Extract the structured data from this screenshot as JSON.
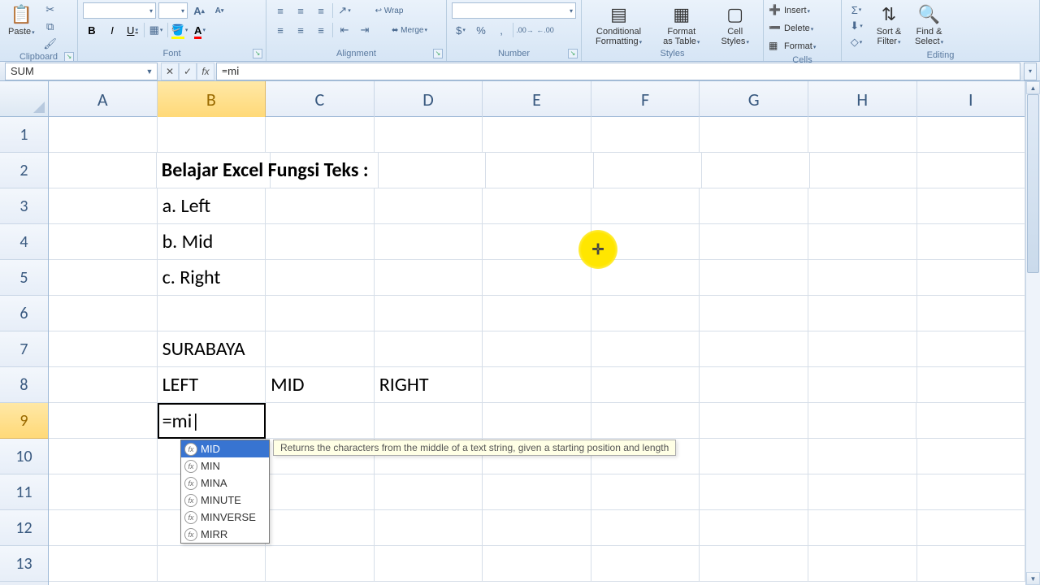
{
  "ribbon": {
    "clipboard": {
      "paste": "Paste",
      "label": "Clipboard"
    },
    "font": {
      "label": "Font",
      "bold": "B",
      "italic": "I",
      "underline": "U",
      "name_val": "",
      "size_val": "",
      "grow": "A",
      "shrink": "A"
    },
    "alignment": {
      "label": "Alignment"
    },
    "number": {
      "label": "Number"
    },
    "styles": {
      "label": "Styles",
      "cond": "Conditional\nFormatting",
      "table": "Format\nas Table",
      "cell": "Cell\nStyles"
    },
    "cells": {
      "label": "Cells",
      "insert": "Insert",
      "delete": "Delete",
      "format": "Format"
    },
    "editing": {
      "label": "Editing",
      "sort": "Sort &\nFilter",
      "find": "Find &\nSelect"
    }
  },
  "formula_bar": {
    "namebox": "SUM",
    "formula": "=mi"
  },
  "columns": [
    "A",
    "B",
    "C",
    "D",
    "E",
    "F",
    "G",
    "H",
    "I"
  ],
  "rows": [
    "1",
    "2",
    "3",
    "4",
    "5",
    "6",
    "7",
    "8",
    "9",
    "10",
    "11",
    "12",
    "13"
  ],
  "active_col": "B",
  "active_row": "9",
  "cells": {
    "B2": "Belajar Excel Fungsi Teks :",
    "B3": "a. Left",
    "B4": "b. Mid",
    "B5": "c. Right",
    "B7": "SURABAYA",
    "B8": "LEFT",
    "C8": "MID",
    "D8": "RIGHT",
    "B9": "=mi"
  },
  "autocomplete": {
    "items": [
      "MID",
      "MIN",
      "MINA",
      "MINUTE",
      "MINVERSE",
      "MIRR"
    ],
    "selected": "MID",
    "tip": "Returns the characters from the middle of a text string, given a starting position and length"
  }
}
